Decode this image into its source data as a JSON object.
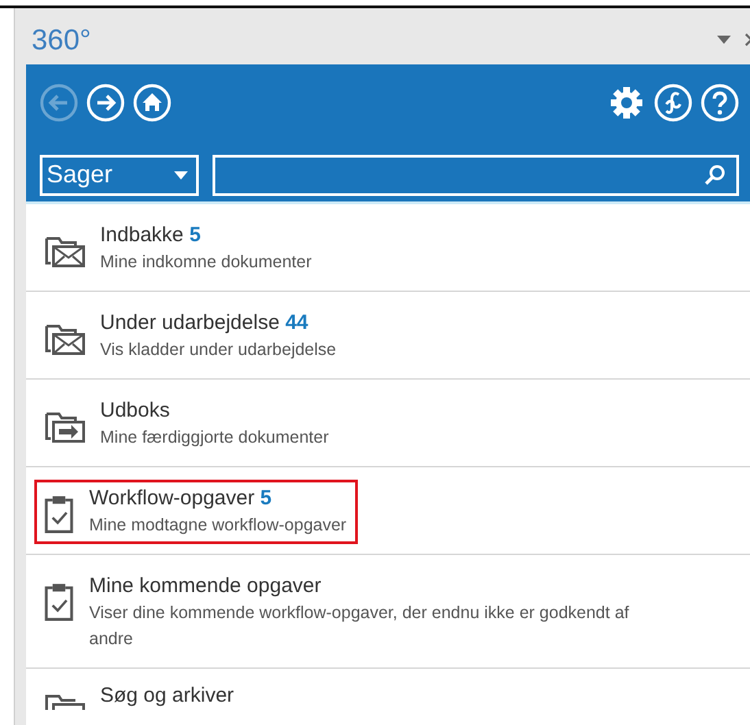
{
  "window": {
    "title": "360°"
  },
  "toolbar": {
    "back_disabled": true
  },
  "search": {
    "scope": "Sager"
  },
  "items": [
    {
      "kind": "inbox",
      "title": "Indbakke",
      "count": "5",
      "subtitle": "Mine indkomne dokumenter",
      "highlighted": false
    },
    {
      "kind": "inbox",
      "title": "Under udarbejdelse",
      "count": "44",
      "subtitle": "Vis kladder under udarbejdelse",
      "highlighted": false
    },
    {
      "kind": "outbox",
      "title": "Udboks",
      "subtitle": "Mine færdiggjorte dokumenter",
      "highlighted": false
    },
    {
      "kind": "task",
      "title": "Workflow-opgaver",
      "count": "5",
      "subtitle": "Mine modtagne workflow-opgaver",
      "highlighted": true
    },
    {
      "kind": "task",
      "title": "Mine kommende opgaver",
      "subtitle": "Viser dine kommende workflow-opgaver, der endnu ikke er godkendt af andre",
      "highlighted": false
    },
    {
      "kind": "archive",
      "title": "Søg og arkiver",
      "highlighted": false
    }
  ]
}
